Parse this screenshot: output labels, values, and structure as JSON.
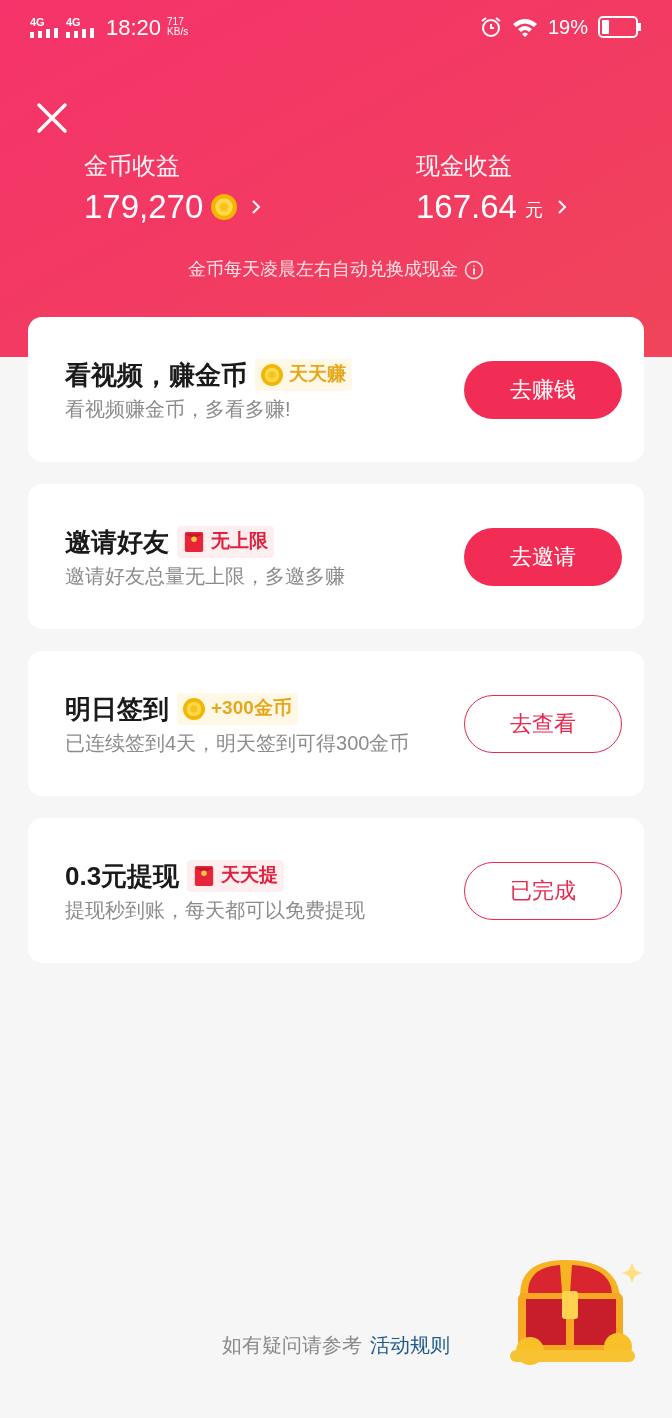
{
  "status_bar": {
    "network_1": "4G",
    "network_2": "4G",
    "time": "18:20",
    "speed_value": "717",
    "speed_unit": "KB/s",
    "battery": "19%"
  },
  "header": {
    "stats": [
      {
        "label": "金币收益",
        "value": "179,270",
        "kind": "coin"
      },
      {
        "label": "现金收益",
        "value": "167.64",
        "unit": "元",
        "kind": "cash"
      }
    ],
    "note": "金币每天凌晨左右自动兑换成现金"
  },
  "tasks": [
    {
      "title": "看视频，赚金币",
      "badge": {
        "kind": "coin",
        "text": "天天赚"
      },
      "description": "看视频赚金币，多看多赚!",
      "button": {
        "label": "去赚钱",
        "kind": "filled"
      }
    },
    {
      "title": "邀请好友",
      "badge": {
        "kind": "envelope",
        "text": "无上限"
      },
      "description": "邀请好友总量无上限，多邀多赚",
      "button": {
        "label": "去邀请",
        "kind": "filled"
      }
    },
    {
      "title": "明日签到",
      "badge": {
        "kind": "coin",
        "text": "+300金币"
      },
      "description": "已连续签到4天，明天签到可得300金币",
      "button": {
        "label": "去查看",
        "kind": "outline"
      }
    },
    {
      "title": "0.3元提现",
      "badge": {
        "kind": "envelope",
        "text": "天天提"
      },
      "description": "提现秒到账，每天都可以免费提现",
      "button": {
        "label": "已完成",
        "kind": "outline"
      }
    }
  ],
  "footer": {
    "text": "如有疑问请参考",
    "link": "活动规则"
  }
}
